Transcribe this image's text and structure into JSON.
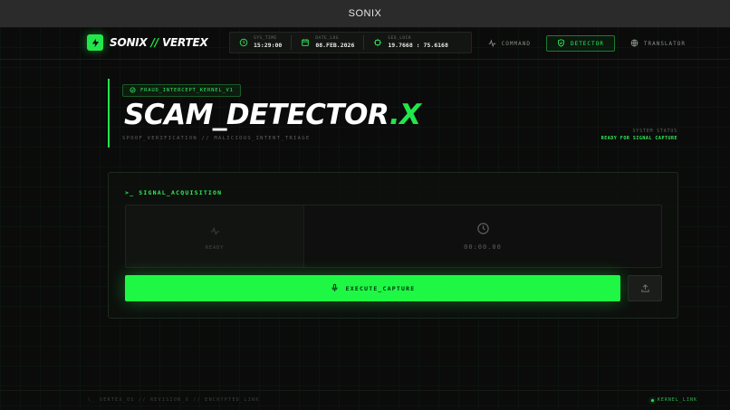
{
  "window": {
    "title": "SONIX"
  },
  "brand": {
    "name_left": "SONIX",
    "slashes": "//",
    "name_right": "VERTEX"
  },
  "stats": [
    {
      "label": "SYS_TIME",
      "value": "15:29:00",
      "icon": "clock-icon"
    },
    {
      "label": "DATE_LOG",
      "value": "08.FEB.2026",
      "icon": "calendar-icon"
    },
    {
      "label": "GEO_LOCK",
      "value": "19.7668 : 75.6168",
      "icon": "crosshair-icon"
    }
  ],
  "nav": [
    {
      "label": "COMMAND",
      "icon": "pulse-icon",
      "active": false
    },
    {
      "label": "DETECTOR",
      "icon": "shield-icon",
      "active": true
    },
    {
      "label": "TRANSLATOR",
      "icon": "globe-icon",
      "active": false
    }
  ],
  "hero": {
    "badge": "FRAUD_INTERCEPT_KERNEL_V1",
    "title_main": "SCAM_DETECTOR",
    "title_accent": ".X",
    "subtitle": "SPOOF_VERIFICATION // MALICIOUS_INTENT_TRIAGE"
  },
  "system": {
    "label": "SYSTEM STATUS",
    "value": "READY FOR SIGNAL CAPTURE"
  },
  "panel": {
    "title_prefix": ">_",
    "title": "SIGNAL_ACQUISITION",
    "status": "READY",
    "timer": "00:00.00",
    "execute_label": "EXECUTE_CAPTURE"
  },
  "footer": {
    "left": "\\_ VERTEX_OS // REVISION_X // ENCRYPTED_LINK",
    "right": "KERNEL_LINK"
  },
  "colors": {
    "accent": "#22e64a",
    "button": "#1ef845",
    "background": "#0a0b0a"
  }
}
